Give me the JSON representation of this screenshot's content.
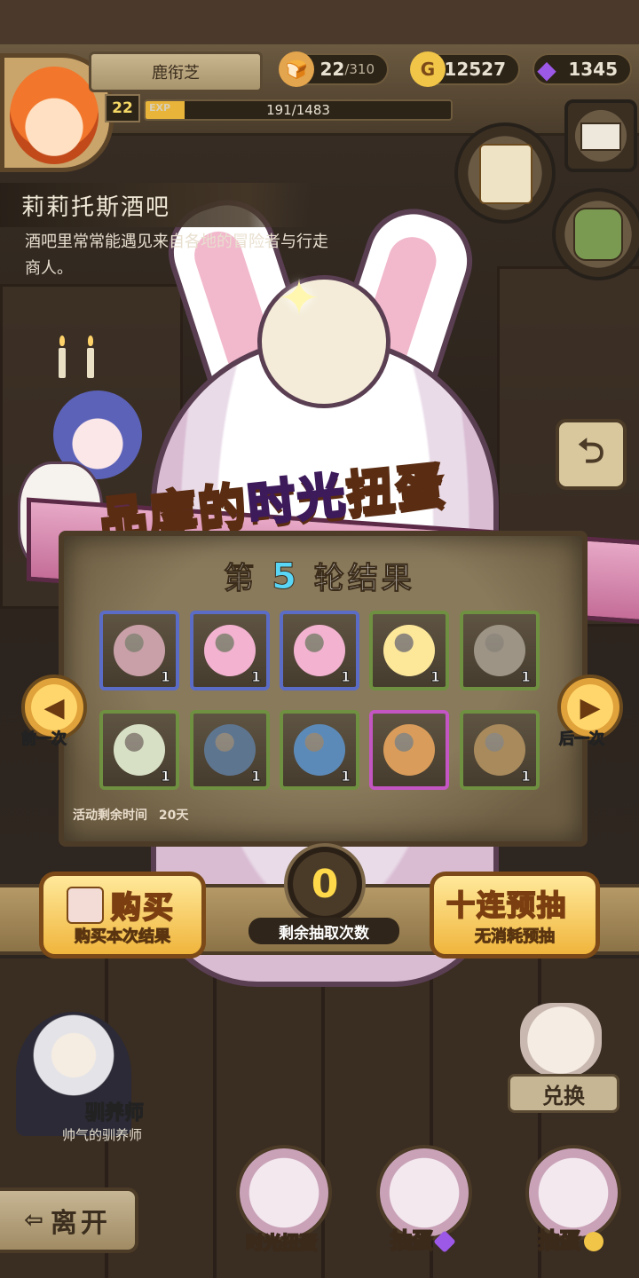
{
  "player": {
    "name": "鹿衔芝",
    "level": "22",
    "exp_tag": "EXP",
    "exp_text": "191/1483",
    "exp_fraction": 0.129
  },
  "resources": {
    "stamina": {
      "value": "22",
      "max": "/310",
      "icon": "bread-icon"
    },
    "gold": {
      "value": "12527",
      "icon": "gold-coin-icon",
      "symbol": "G"
    },
    "gems": {
      "value": "1345",
      "icon": "purple-gem-icon"
    }
  },
  "location": {
    "title": "莉莉托斯酒吧",
    "description": "酒吧里常常能遇见来自各地的冒险者与行走商人。"
  },
  "banner": {
    "title_part1": "品库的",
    "title_accent": "时光",
    "title_part2": "扭蛋"
  },
  "results": {
    "round_prefix": "第",
    "round_number": "5",
    "round_suffix": "轮结果",
    "items": [
      {
        "icon": "book-item-icon",
        "rarity": "blue",
        "qty": "1",
        "color": "#c9a0a8"
      },
      {
        "icon": "pink-bundle-icon",
        "rarity": "blue",
        "qty": "1",
        "color": "#f2b2d0"
      },
      {
        "icon": "pink-bundle-icon",
        "rarity": "blue",
        "qty": "1",
        "color": "#f2b2d0"
      },
      {
        "icon": "glowing-orb-icon",
        "rarity": "green",
        "qty": "1",
        "color": "#fde89a"
      },
      {
        "icon": "fur-hat-icon",
        "rarity": "green",
        "qty": "1",
        "color": "#9d9486"
      },
      {
        "icon": "spotted-egg-icon",
        "rarity": "green",
        "qty": "1",
        "color": "#d7e0c4"
      },
      {
        "icon": "blue-shell-icon",
        "rarity": "green",
        "qty": "1",
        "color": "#5e7590"
      },
      {
        "icon": "blue-sprout-icon",
        "rarity": "green",
        "qty": "1",
        "color": "#5c8ab8"
      },
      {
        "icon": "tiger-box-icon",
        "rarity": "purple",
        "qty": "",
        "color": "#d99c5a"
      },
      {
        "icon": "wooden-barrel-icon",
        "rarity": "green",
        "qty": "1",
        "color": "#a88a5c"
      }
    ],
    "event_time_label": "活动剩余时间",
    "event_time_value": "20天"
  },
  "nav": {
    "prev_label": "前一次",
    "next_label": "后一次"
  },
  "actions": {
    "buy_main": "购买",
    "buy_sub": "购买本次结果",
    "draws_left_value": "0",
    "draws_left_label": "剩余抽取次数",
    "ten_main": "十连预抽",
    "ten_sub_highlight": "无消耗",
    "ten_sub_rest": "预抽"
  },
  "character": {
    "name": "驯养师",
    "title": "帅气的驯养师"
  },
  "bottom": {
    "exchange_label": "兑换",
    "leave_label": "离开",
    "time_gacha_label": "时光扭蛋",
    "draw_gem_label": "抽蛋",
    "draw_gold_label": "抽蛋"
  },
  "colors": {
    "accent_gold": "#f0b53c",
    "round_number": "#59d6f6",
    "rarity_blue": "#5a6cc6",
    "rarity_green": "#6f9040",
    "rarity_purple": "#c456c4"
  }
}
